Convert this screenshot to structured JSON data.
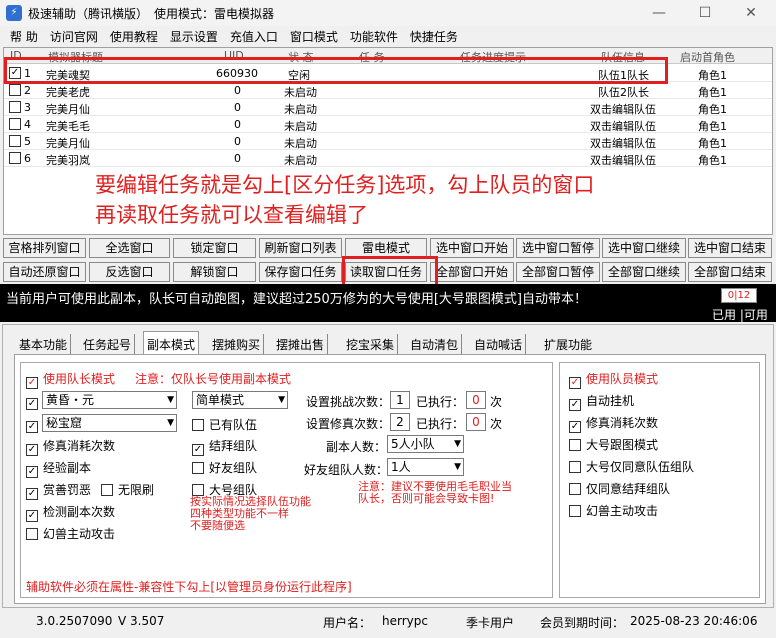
{
  "window": {
    "title": "极速辅助（腾讯横版）　使用模式：雷电模拟器",
    "app_icon": "app-icon",
    "controls": [
      "—",
      "☐",
      "✕"
    ]
  },
  "menu": [
    "帮 助",
    "访问官网",
    "使用教程",
    "显示设置",
    "充值入口",
    "窗口模式",
    "功能软件",
    "快捷任务"
  ],
  "grid": {
    "columns": [
      "ID",
      "模拟器标题",
      "UID",
      "状 态",
      "任 务",
      "任务进度提示",
      "队伍信息",
      "启动首角色"
    ],
    "rows": [
      {
        "id": "1",
        "title": "完美魂契",
        "uid": "660930",
        "status": "空闲",
        "task": "",
        "progress": "",
        "team": "队伍1队长",
        "role": "角色1",
        "checked": "✓"
      },
      {
        "id": "2",
        "title": "完美老虎",
        "uid": "0",
        "status": "未启动",
        "task": "",
        "progress": "",
        "team": "队伍2队长",
        "role": "角色1",
        "checked": ""
      },
      {
        "id": "3",
        "title": "完美月仙",
        "uid": "0",
        "status": "未启动",
        "task": "",
        "progress": "",
        "team": "双击编辑队伍",
        "role": "角色1",
        "checked": ""
      },
      {
        "id": "4",
        "title": "完美毛毛",
        "uid": "0",
        "status": "未启动",
        "task": "",
        "progress": "",
        "team": "双击编辑队伍",
        "role": "角色1",
        "checked": ""
      },
      {
        "id": "5",
        "title": "完美月仙",
        "uid": "0",
        "status": "未启动",
        "task": "",
        "progress": "",
        "team": "双击编辑队伍",
        "role": "角色1",
        "checked": ""
      },
      {
        "id": "6",
        "title": "完美羽岚",
        "uid": "0",
        "status": "未启动",
        "task": "",
        "progress": "",
        "team": "双击编辑队伍",
        "role": "角色1",
        "checked": ""
      }
    ],
    "annotation_line1": "要编辑任务就是勾上[区分任务]选项，勾上队员的窗口",
    "annotation_line2": "再读取任务就可以查看编辑了"
  },
  "buttons_row1": [
    "宫格排列窗口",
    "全选窗口",
    "锁定窗口",
    "刷新窗口列表",
    "雷电模式",
    "选中窗口开始",
    "选中窗口暂停",
    "选中窗口继续",
    "选中窗口结束"
  ],
  "buttons_row2": [
    "自动还原窗口",
    "反选窗口",
    "解锁窗口",
    "保存窗口任务",
    "读取窗口任务",
    "全部窗口开始",
    "全部窗口暂停",
    "全部窗口继续",
    "全部窗口结束"
  ],
  "status": {
    "message": "当前用户可使用此副本，队长可自动跑图，建议超过250万修为的大号使用[大号跟图模式]自动带本！",
    "counter": "0|12",
    "used_label": "已用 |可用"
  },
  "tabs": [
    "基本功能",
    "任务起号",
    "副本模式",
    "摆摊购买",
    "摆摊出售",
    "挖宝采集",
    "自动清包",
    "自动喊话",
    "扩展功能"
  ],
  "active_tab": "副本模式",
  "left": {
    "use_leader": "使用队长模式",
    "leader_note": "注意：仅队长号使用副本模式",
    "combo_time": "黄昏・元",
    "combo_place": "秘宝窟",
    "combo_mode": "简单模式",
    "repair": "修真消耗次数",
    "exp": "经验副本",
    "reward": "赏善罚恶",
    "unlimited": "无限刷",
    "detect": "检测副本次数",
    "beast": "幻兽主动攻击",
    "has_team": "已有队伍",
    "sworn": "结拜组队",
    "friend": "好友组队",
    "big_team": "大号组队",
    "team_note": "按实际情况选择队伍功能\n四种类型功能不一样\n不要随便选",
    "challenge_label": "设置挑战次数：",
    "challenge_val": "1",
    "executed_label": "已执行：",
    "executed1": "0",
    "times_unit": "次",
    "repair_label": "设置修真次数：",
    "repair_val": "2",
    "executed2": "0",
    "count_label": "副本人数：",
    "count_val": "5人小队",
    "friend_count_label": "好友组队人数：",
    "friend_count_val": "1人",
    "advice": "注意：建议不要使用毛毛职业当\n队长，否则可能会导致卡图!",
    "footer_note": "辅助软件必须在属性-兼容性下勾上[以管理员身份运行此程序]"
  },
  "right": {
    "use_member": "使用队员模式",
    "auto_hang": "自动挂机",
    "repair": "修真消耗次数",
    "big_follow": "大号跟图模式",
    "big_accept": "大号仅同意队伍组队",
    "accept_sworn": "仅同意结拜组队",
    "beast": "幻兽主动攻击"
  },
  "bottom": {
    "version": "3.0.2507090",
    "v": "V 3.507",
    "user_label": "用户名：",
    "user": "herrypc",
    "plan": "季卡用户",
    "expire_label": "会员到期时间：",
    "expire": "2025-08-23 20:46:06"
  }
}
